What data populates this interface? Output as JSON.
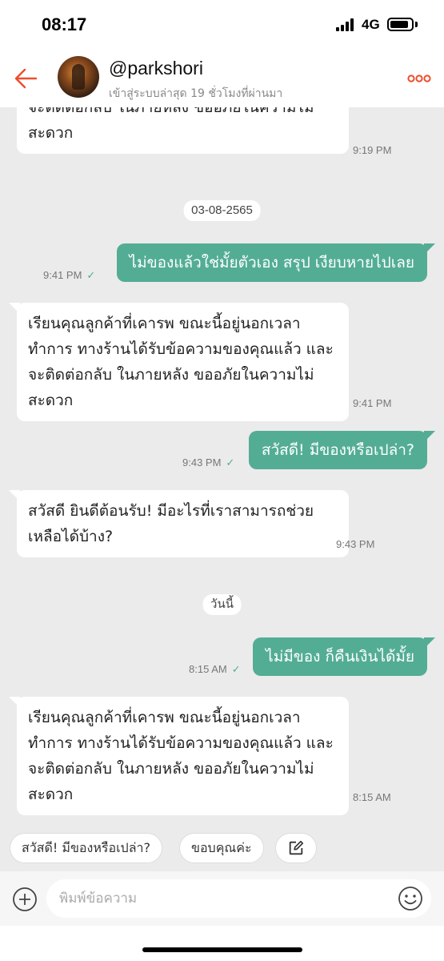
{
  "status_bar": {
    "time": "08:17",
    "network": "4G"
  },
  "header": {
    "username": "@parkshori",
    "last_seen": "เข้าสู่ระบบล่าสุด 19 ชั่วโมงที่ผ่านมา"
  },
  "messages": {
    "m1": {
      "text": "จะติดต่อกลับ ในภายหลัง ขออภัยในความไม่สะดวก",
      "time": "9:19 PM"
    },
    "date1": "03-08-2565",
    "m2": {
      "text": "ไม่ของแล้วใช่มั้ยตัวเอง สรุป เงียบหายไปเลย",
      "time": "9:41 PM"
    },
    "m3": {
      "text": "เรียนคุณลูกค้าที่เคารพ ขณะนี้อยู่นอกเวลาทำการ ทางร้านได้รับข้อความของคุณแล้ว และจะติดต่อกลับ ในภายหลัง ขออภัยในความไม่สะดวก",
      "time": "9:41 PM"
    },
    "m4": {
      "text": "สวัสดี! มีของหรือเปล่า?",
      "time": "9:43 PM"
    },
    "m5": {
      "text": "สวัสดี ยินดีต้อนรับ! มีอะไรที่เราสามารถช่วยเหลือได้บ้าง?",
      "time": "9:43 PM"
    },
    "date2": "วันนี้",
    "m6": {
      "text": "ไม่มีของ ก็คืนเงินได้มั้ย",
      "time": "8:15 AM"
    },
    "m7": {
      "text": "เรียนคุณลูกค้าที่เคารพ ขณะนี้อยู่นอกเวลาทำการ ทางร้านได้รับข้อความของคุณแล้ว และจะติดต่อกลับ ในภายหลัง ขออภัยในความไม่สะดวก",
      "time": "8:15 AM"
    }
  },
  "quick_replies": {
    "r1": "สวัสดี! มีของหรือเปล่า?",
    "r2": "ขอบคุณค่ะ"
  },
  "input": {
    "placeholder": "พิมพ์ข้อความ"
  },
  "colors": {
    "accent": "#ee4d2d",
    "outgoing_bubble": "#53ad94",
    "chat_background": "#ebebeb"
  },
  "icons": [
    "back-arrow-icon",
    "more-icon",
    "read-check-icon",
    "edit-icon",
    "add-icon",
    "emoji-icon"
  ]
}
